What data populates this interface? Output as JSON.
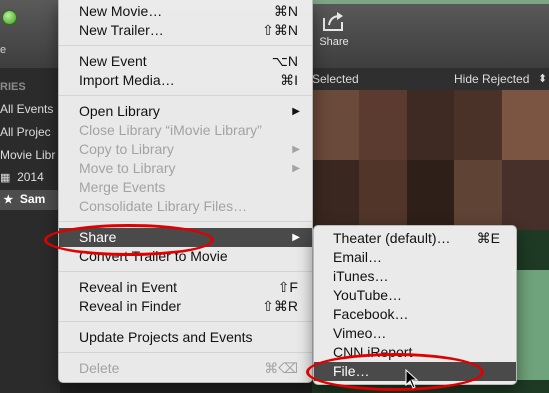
{
  "toolbar": {
    "share_label": "Share"
  },
  "filter": {
    "selected_label": "Selected",
    "hide_rejected": "Hide Rejected"
  },
  "sidebar": {
    "header": "RIES",
    "items": [
      "All Events",
      "All Projec",
      "Movie Libr",
      "2014",
      "Sam"
    ]
  },
  "menu": {
    "new_movie": {
      "label": "New Movie…",
      "shortcut": "⌘N"
    },
    "new_trailer": {
      "label": "New Trailer…",
      "shortcut": "⇧⌘N"
    },
    "new_event": {
      "label": "New Event",
      "shortcut": "⌥N"
    },
    "import_media": {
      "label": "Import Media…",
      "shortcut": "⌘I"
    },
    "open_library": {
      "label": "Open Library"
    },
    "close_library": {
      "label": "Close Library “iMovie Library”"
    },
    "copy_to_library": {
      "label": "Copy to Library"
    },
    "move_to_library": {
      "label": "Move to Library"
    },
    "merge_events": {
      "label": "Merge Events"
    },
    "consolidate": {
      "label": "Consolidate Library Files…"
    },
    "share": {
      "label": "Share"
    },
    "convert_trailer": {
      "label": "Convert Trailer to Movie"
    },
    "reveal_event": {
      "label": "Reveal in Event",
      "shortcut": "⇧F"
    },
    "reveal_finder": {
      "label": "Reveal in Finder",
      "shortcut": "⇧⌘R"
    },
    "update_projects": {
      "label": "Update Projects and Events"
    },
    "delete": {
      "label": "Delete",
      "shortcut": "⌘⌫"
    }
  },
  "submenu": {
    "items": [
      {
        "label": "Theater (default)…",
        "shortcut": "⌘E"
      },
      {
        "label": "Email…"
      },
      {
        "label": "iTunes…"
      },
      {
        "label": "YouTube…"
      },
      {
        "label": "Facebook…"
      },
      {
        "label": "Vimeo…"
      },
      {
        "label": "CNN iReport"
      },
      {
        "label": "File…"
      }
    ]
  },
  "colors": {
    "annotation": "#e00000",
    "highlight": "#4a4a4a"
  }
}
